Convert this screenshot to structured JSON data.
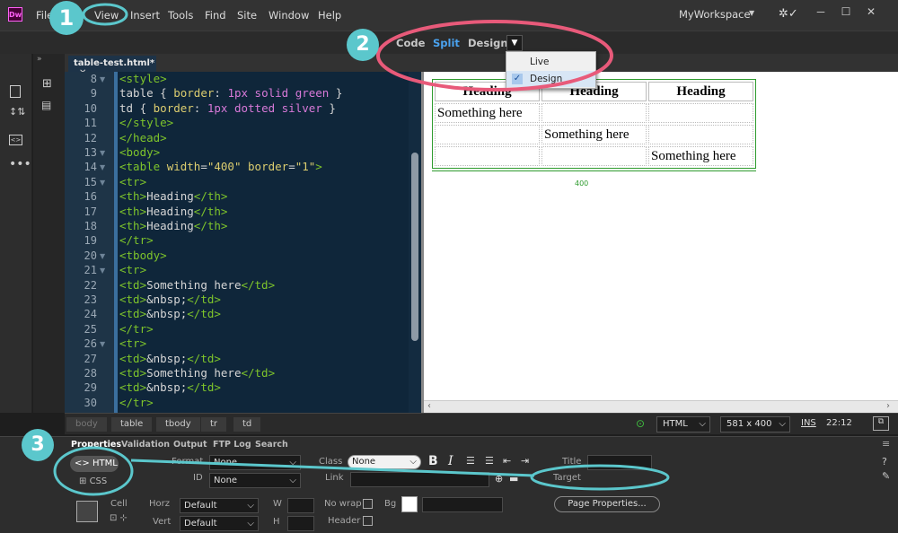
{
  "menubar": {
    "items": [
      "File",
      "View",
      "Insert",
      "Tools",
      "Find",
      "Site",
      "Window",
      "Help"
    ],
    "workspace": "MyWorkspace",
    "logo": "Dw"
  },
  "viewbar": {
    "code": "Code",
    "split": "Split",
    "design": "Design"
  },
  "viewmenu": {
    "items": [
      "Live",
      "Design"
    ],
    "checked": "Design"
  },
  "tab": {
    "name": "table-test.html*"
  },
  "code": {
    "lines": [
      {
        "n": "8",
        "t": [
          [
            "tg",
            "<style>"
          ]
        ]
      },
      {
        "n": "9",
        "t": [
          [
            "pn",
            "table { "
          ],
          [
            "at",
            "border"
          ],
          [
            "pn",
            ": "
          ],
          [
            "vl",
            "1px solid green"
          ],
          [
            "pn",
            " }"
          ]
        ]
      },
      {
        "n": "10",
        "t": [
          [
            "pn",
            "td { "
          ],
          [
            "at",
            "border"
          ],
          [
            "pn",
            ": "
          ],
          [
            "vl",
            "1px dotted silver"
          ],
          [
            "pn",
            " }"
          ]
        ]
      },
      {
        "n": "11",
        "t": [
          [
            "tg",
            "</style>"
          ]
        ]
      },
      {
        "n": "12",
        "t": [
          [
            "tg",
            "</head>"
          ]
        ]
      },
      {
        "n": "13",
        "t": [
          [
            "tg",
            "<body>"
          ]
        ]
      },
      {
        "n": "14",
        "t": [
          [
            "tg",
            "<table "
          ],
          [
            "at",
            "width"
          ],
          [
            "pn",
            "="
          ],
          [
            "pr",
            "\"400\""
          ],
          [
            "pn",
            " "
          ],
          [
            "at",
            "border"
          ],
          [
            "pn",
            "="
          ],
          [
            "pr",
            "\"1\""
          ],
          [
            "tg",
            ">"
          ]
        ]
      },
      {
        "n": "15",
        "t": [
          [
            "tg",
            "<tr>"
          ]
        ]
      },
      {
        "n": "16",
        "t": [
          [
            "tg",
            "<th>"
          ],
          [
            "pn",
            "Heading"
          ],
          [
            "tg",
            "</th>"
          ]
        ]
      },
      {
        "n": "17",
        "t": [
          [
            "tg",
            "<th>"
          ],
          [
            "pn",
            "Heading"
          ],
          [
            "tg",
            "</th>"
          ]
        ]
      },
      {
        "n": "18",
        "t": [
          [
            "tg",
            "<th>"
          ],
          [
            "pn",
            "Heading"
          ],
          [
            "tg",
            "</th>"
          ]
        ]
      },
      {
        "n": "19",
        "t": [
          [
            "tg",
            "</tr>"
          ]
        ]
      },
      {
        "n": "20",
        "t": [
          [
            "tg",
            "<tbody>"
          ]
        ]
      },
      {
        "n": "21",
        "t": [
          [
            "tg",
            "<tr>"
          ]
        ]
      },
      {
        "n": "22",
        "t": [
          [
            "tg",
            "<td>"
          ],
          [
            "pn",
            "Something here"
          ],
          [
            "tg",
            "</td>"
          ]
        ]
      },
      {
        "n": "23",
        "t": [
          [
            "tg",
            "<td>"
          ],
          [
            "pn",
            "&nbsp;"
          ],
          [
            "tg",
            "</td>"
          ]
        ]
      },
      {
        "n": "24",
        "t": [
          [
            "tg",
            "<td>"
          ],
          [
            "pn",
            "&nbsp;"
          ],
          [
            "tg",
            "</td>"
          ]
        ]
      },
      {
        "n": "25",
        "t": [
          [
            "tg",
            "</tr>"
          ]
        ]
      },
      {
        "n": "26",
        "t": [
          [
            "tg",
            "<tr>"
          ]
        ]
      },
      {
        "n": "27",
        "t": [
          [
            "tg",
            "<td>"
          ],
          [
            "pn",
            "&nbsp;"
          ],
          [
            "tg",
            "</td>"
          ]
        ]
      },
      {
        "n": "28",
        "t": [
          [
            "tg",
            "<td>"
          ],
          [
            "pn",
            "Something here"
          ],
          [
            "tg",
            "</td>"
          ]
        ]
      },
      {
        "n": "29",
        "t": [
          [
            "tg",
            "<td>"
          ],
          [
            "pn",
            "&nbsp;"
          ],
          [
            "tg",
            "</td>"
          ]
        ]
      },
      {
        "n": "30",
        "t": [
          [
            "tg",
            "</tr>"
          ]
        ]
      }
    ]
  },
  "design": {
    "headings": [
      "Heading",
      "Heading",
      "Heading"
    ],
    "rows": [
      [
        "Something here",
        "",
        ""
      ],
      [
        "",
        "Something here",
        ""
      ],
      [
        "",
        "",
        "Something here"
      ]
    ],
    "width_label": "400"
  },
  "tagbar": {
    "tags": [
      "body",
      "table",
      "tbody",
      "tr",
      "td"
    ],
    "mode": "HTML",
    "size": "581 x 400",
    "ins": "INS",
    "pos": "22:12"
  },
  "props": {
    "tabs": [
      "Properties",
      "Validation",
      "Output",
      "FTP Log",
      "Search"
    ],
    "html_btn": "HTML",
    "css_btn": "CSS",
    "format_label": "Format",
    "format_value": "None",
    "id_label": "ID",
    "id_value": "None",
    "class_label": "Class",
    "class_value": "None",
    "link_label": "Link",
    "title_label": "Title",
    "target_label": "Target",
    "cell_label": "Cell",
    "horz_label": "Horz",
    "horz_value": "Default",
    "vert_label": "Vert",
    "vert_value": "Default",
    "w_label": "W",
    "h_label": "H",
    "nowrap_label": "No wrap",
    "header_label": "Header",
    "bg_label": "Bg",
    "page_props": "Page Properties..."
  },
  "annotations": [
    "1",
    "2",
    "3"
  ],
  "colors": {
    "accent": "#5bc7cc",
    "highlight": "#e85a7a",
    "split_active": "#4aa3f0"
  }
}
